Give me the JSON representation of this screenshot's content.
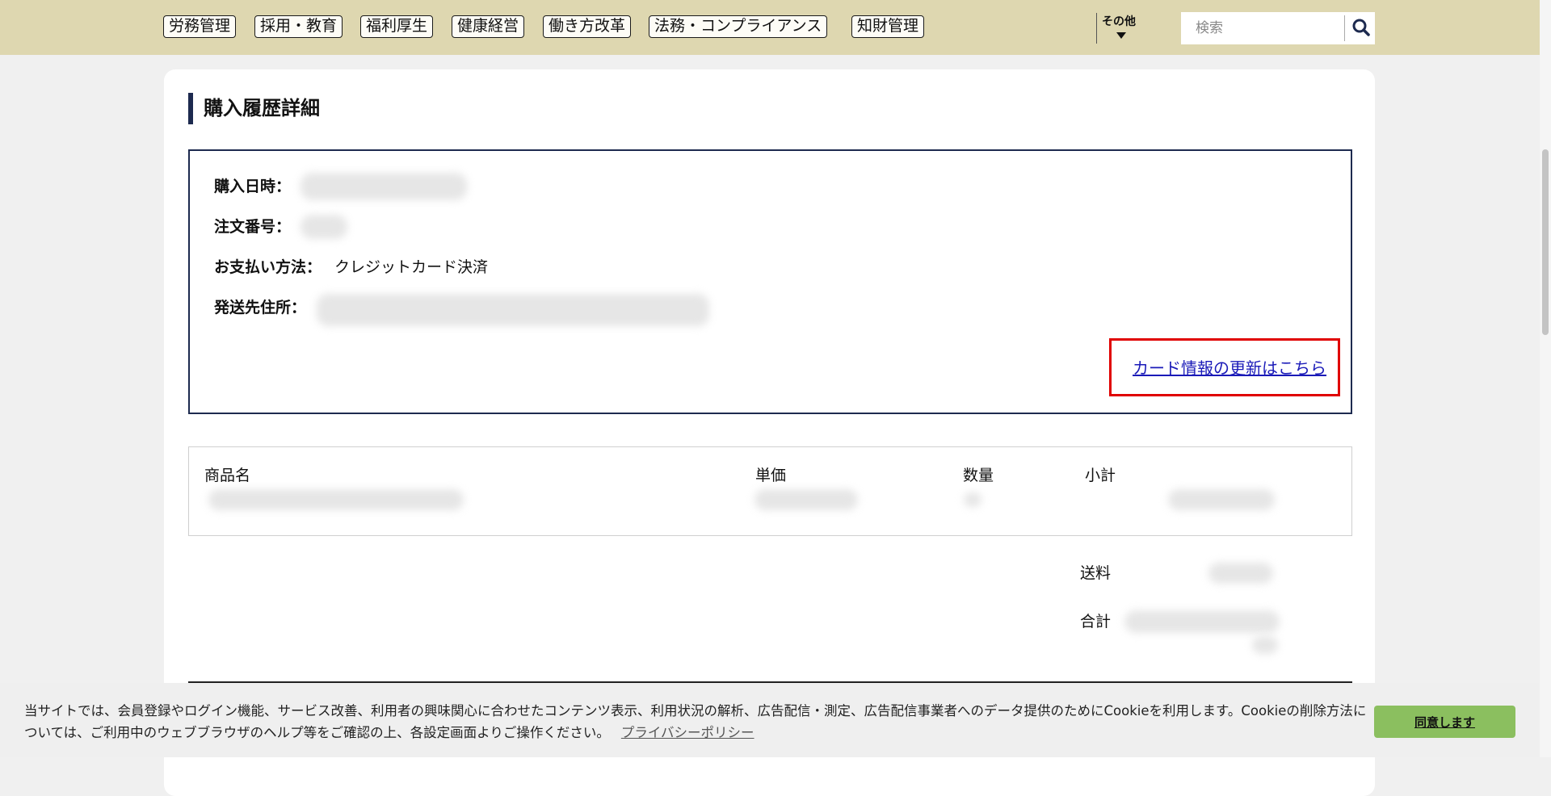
{
  "nav": {
    "categories": [
      "労務管理",
      "採用・教育",
      "福利厚生",
      "健康経営",
      "働き方改革",
      "法務・コンプライアンス",
      "知財管理"
    ],
    "other_label": "その他",
    "search_placeholder": "検索"
  },
  "page": {
    "title": "購入履歴詳細"
  },
  "order": {
    "purchase_date_label": "購入日時：",
    "order_number_label": "注文番号：",
    "payment_method_label": "お支払い方法：",
    "payment_method_value": "クレジットカード決済",
    "shipping_address_label": "発送先住所：",
    "card_update_link": "カード情報の更新はこちら"
  },
  "items_table": {
    "headers": [
      "商品名",
      "単価",
      "数量",
      "小計"
    ]
  },
  "summary": {
    "shipping_label": "送料",
    "total_label": "合計"
  },
  "cookie": {
    "message": "当サイトでは、会員登録やログイン機能、サービス改善、利用者の興味関心に合わせたコンテンツ表示、利用状況の解析、広告配信・測定、広告配信事業者へのデータ提供のためにCookieを利用します。Cookieの削除方法については、ご利用中のウェブブラウザのヘルプ等をご確認の上、各設定画面よりご操作ください。",
    "privacy_link": "プライバシーポリシー",
    "agree_button": "同意します"
  },
  "icons": {
    "search": "search-icon",
    "dropdown": "caret-down-icon"
  }
}
